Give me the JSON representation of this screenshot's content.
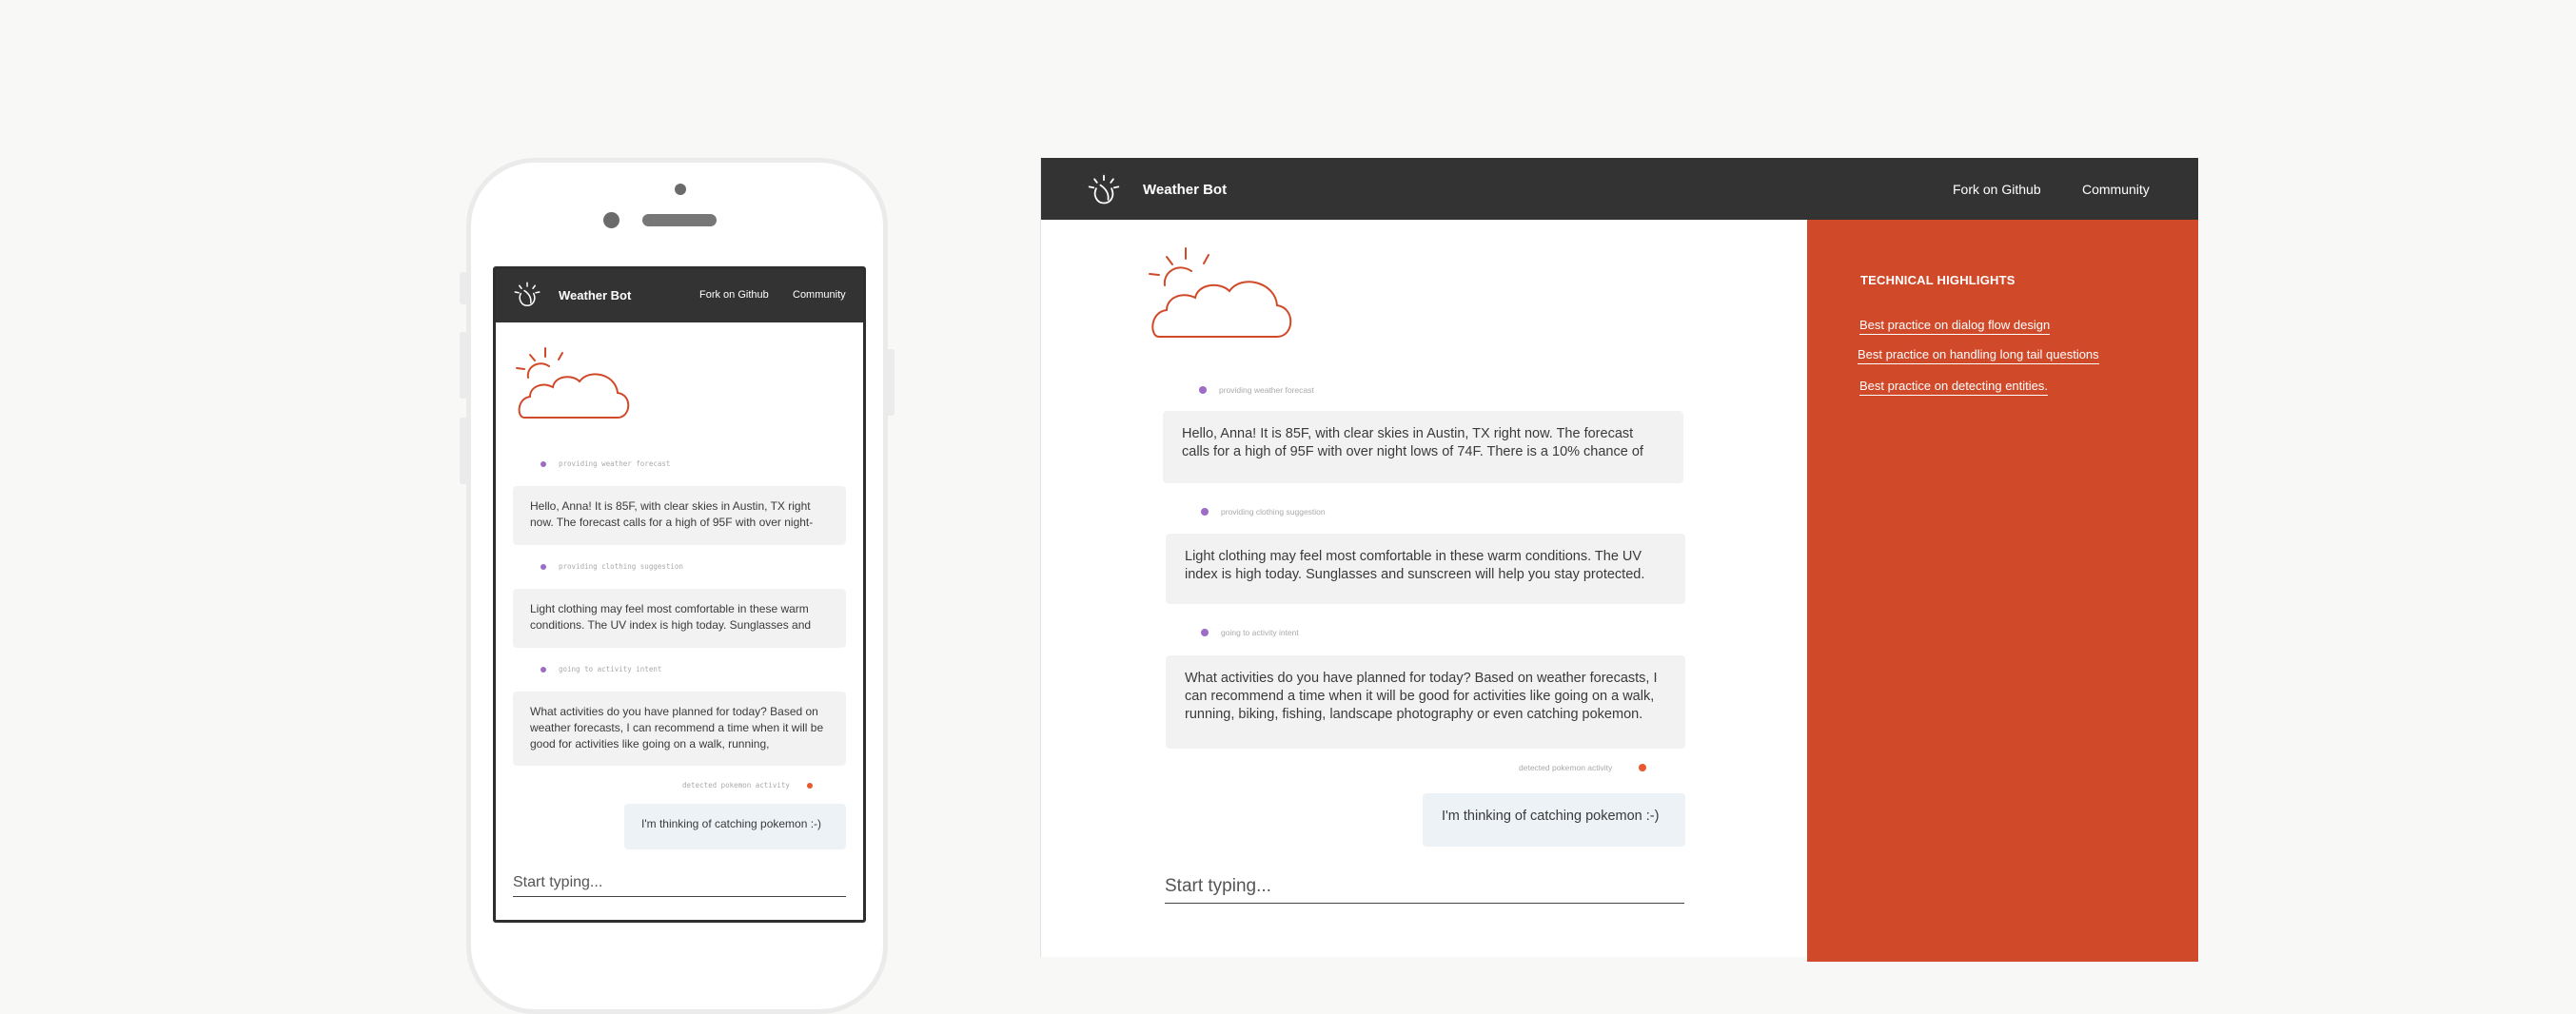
{
  "app": {
    "brand": "Weather Bot",
    "nav_links": [
      "Fork on Github",
      "Community"
    ]
  },
  "colors": {
    "nav_bg": "#333333",
    "accent": "#d04a2a",
    "bot_dot": "#9d6cc7",
    "user_dot": "#e7592f",
    "bot_bubble": "#f3f2f2",
    "user_bubble": "#edf2f6"
  },
  "phone": {
    "messages": [
      {
        "label": "providing weather forecast",
        "text": "Hello, Anna! It is 85F, with clear skies in Austin, TX right now. The forecast calls for a high of 95F with over night-"
      },
      {
        "label": "providing clothing suggestion",
        "text": "Light clothing may feel most comfortable in these warm conditions. The UV index is high today. Sunglasses and"
      },
      {
        "label": "going to activity intent",
        "text": "What activities do you have planned for today? Based on weather forecasts, I can recommend a time when it will be good for activities like going on a walk, running,"
      },
      {
        "label": "detected pokemon activity",
        "text": "I'm thinking of catching pokemon :-)"
      }
    ],
    "input_placeholder": "Start typing..."
  },
  "desktop": {
    "messages": [
      {
        "label": "providing weather forecast",
        "text": "Hello, Anna! It is 85F, with clear skies in Austin, TX right now. The forecast calls for a high of 95F with over night lows of 74F. There is a 10% chance of"
      },
      {
        "label": "providing clothing suggestion",
        "text": "Light clothing may feel most comfortable in these warm conditions. The UV index is high today. Sunglasses and sunscreen will help you stay protected."
      },
      {
        "label": "going to activity intent",
        "text": "What activities do you have planned for today? Based on weather forecasts, I can recommend a time when it will be good for activities like going on a walk, running, biking, fishing, landscape photography or even catching pokemon."
      },
      {
        "label": "detected pokemon activity",
        "text": "I'm thinking of catching pokemon :-)"
      }
    ],
    "input_placeholder": "Start typing...",
    "sidebar": {
      "title": "TECHNICAL HIGHLIGHTS",
      "links": [
        "Best practice on dialog flow design",
        "Best practice on handling long tail questions",
        "Best practice on detecting entities."
      ]
    }
  },
  "icons": {
    "logo": "watson-logo-icon",
    "weather": "sun-cloud-icon"
  }
}
